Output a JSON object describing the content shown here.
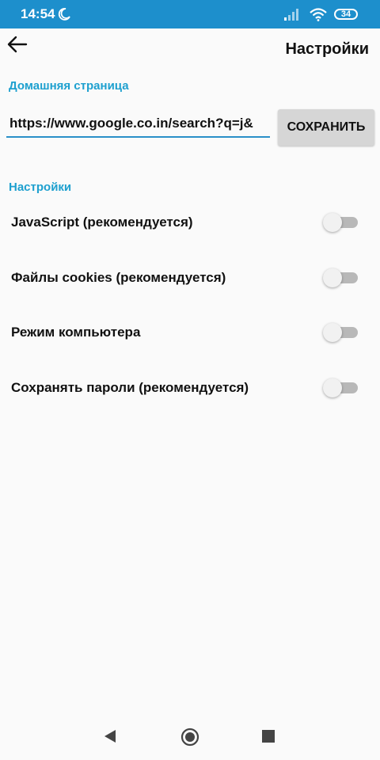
{
  "status_bar": {
    "time": "14:54",
    "battery": "34",
    "icons": [
      "moon-icon",
      "signal-icon",
      "wifi-icon",
      "battery-icon"
    ]
  },
  "app_bar": {
    "title": "Настройки",
    "back_icon": "arrow-left-icon"
  },
  "homepage": {
    "section_label": "Домашняя страница",
    "url_value": "https://www.google.co.in/search?q=j&",
    "save_label": "СОХРАНИТЬ"
  },
  "settings": {
    "section_label": "Настройки",
    "items": [
      {
        "label": "JavaScript (рекомендуется)",
        "enabled": false
      },
      {
        "label": "Файлы cookies (рекомендуется)",
        "enabled": false
      },
      {
        "label": "Режим компьютера",
        "enabled": false
      },
      {
        "label": "Сохранять пароли (рекомендуется)",
        "enabled": false
      }
    ]
  },
  "nav_bar": {
    "icons": [
      "nav-back-icon",
      "nav-home-icon",
      "nav-recents-icon"
    ]
  },
  "colors": {
    "status_bar": "#1d8fcc",
    "accent": "#1ea0cf",
    "background": "#fafafa",
    "button": "#d6d6d6"
  }
}
